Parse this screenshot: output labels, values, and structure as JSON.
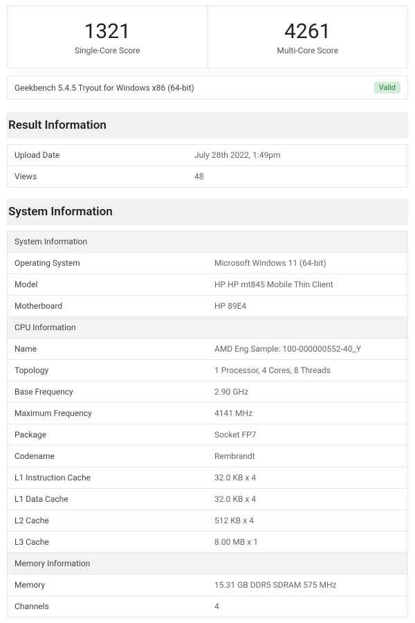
{
  "scores": {
    "single": {
      "value": "1321",
      "label": "Single-Core Score"
    },
    "multi": {
      "value": "4261",
      "label": "Multi-Core Score"
    }
  },
  "version_line": "Geekbench 5.4.5 Tryout for Windows x86 (64-bit)",
  "valid_badge": "Valid",
  "result_info": {
    "heading": "Result Information",
    "rows": {
      "upload_date": {
        "label": "Upload Date",
        "value": "July 28th 2022, 1:49pm"
      },
      "views": {
        "label": "Views",
        "value": "48"
      }
    }
  },
  "system_info": {
    "heading": "System Information",
    "sys_sub": "System Information",
    "os": {
      "label": "Operating System",
      "value": "Microsoft Windows 11 (64-bit)"
    },
    "model": {
      "label": "Model",
      "value": "HP HP mt845 Mobile Thin Client"
    },
    "mb": {
      "label": "Motherboard",
      "value": "HP 89E4"
    },
    "cpu_sub": "CPU Information",
    "cpu_name": {
      "label": "Name",
      "value": "AMD Eng Sample: 100-000000552-40_Y"
    },
    "topology": {
      "label": "Topology",
      "value": "1 Processor, 4 Cores, 8 Threads"
    },
    "base_freq": {
      "label": "Base Frequency",
      "value": "2.90 GHz"
    },
    "max_freq": {
      "label": "Maximum Frequency",
      "value": "4141 MHz"
    },
    "package": {
      "label": "Package",
      "value": "Socket FP7"
    },
    "codename": {
      "label": "Codename",
      "value": "Rembrandt"
    },
    "l1i": {
      "label": "L1 Instruction Cache",
      "value": "32.0 KB x 4"
    },
    "l1d": {
      "label": "L1 Data Cache",
      "value": "32.0 KB x 4"
    },
    "l2": {
      "label": "L2 Cache",
      "value": "512 KB x 4"
    },
    "l3": {
      "label": "L3 Cache",
      "value": "8.00 MB x 1"
    },
    "mem_sub": "Memory Information",
    "memory": {
      "label": "Memory",
      "value": "15.31 GB DDR5 SDRAM 575 MHz"
    },
    "channels": {
      "label": "Channels",
      "value": "4"
    }
  }
}
